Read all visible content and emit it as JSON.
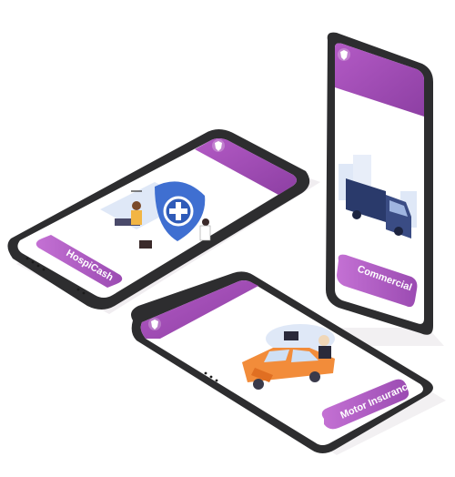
{
  "colors": {
    "phone_frame": "#2d2d2f",
    "screen": "#ffffff",
    "header_purple": "#a24fb5",
    "header_purple_dark": "#8a3d9e",
    "button_purple": "#b062c4",
    "shield_blue": "#3f6fd1",
    "truck_navy": "#2a3a6b",
    "car_orange": "#f28c3a"
  },
  "phones": [
    {
      "id": "hospicash",
      "button_label": "HospiCash",
      "illustration": "hospital-doctor-shield"
    },
    {
      "id": "commercial",
      "button_label": "Commercial",
      "illustration": "delivery-truck"
    },
    {
      "id": "motor",
      "button_label": "Motor Insurance",
      "illustration": "crashed-car"
    }
  ],
  "icons": {
    "logo": "shield-heart-logo-icon"
  }
}
